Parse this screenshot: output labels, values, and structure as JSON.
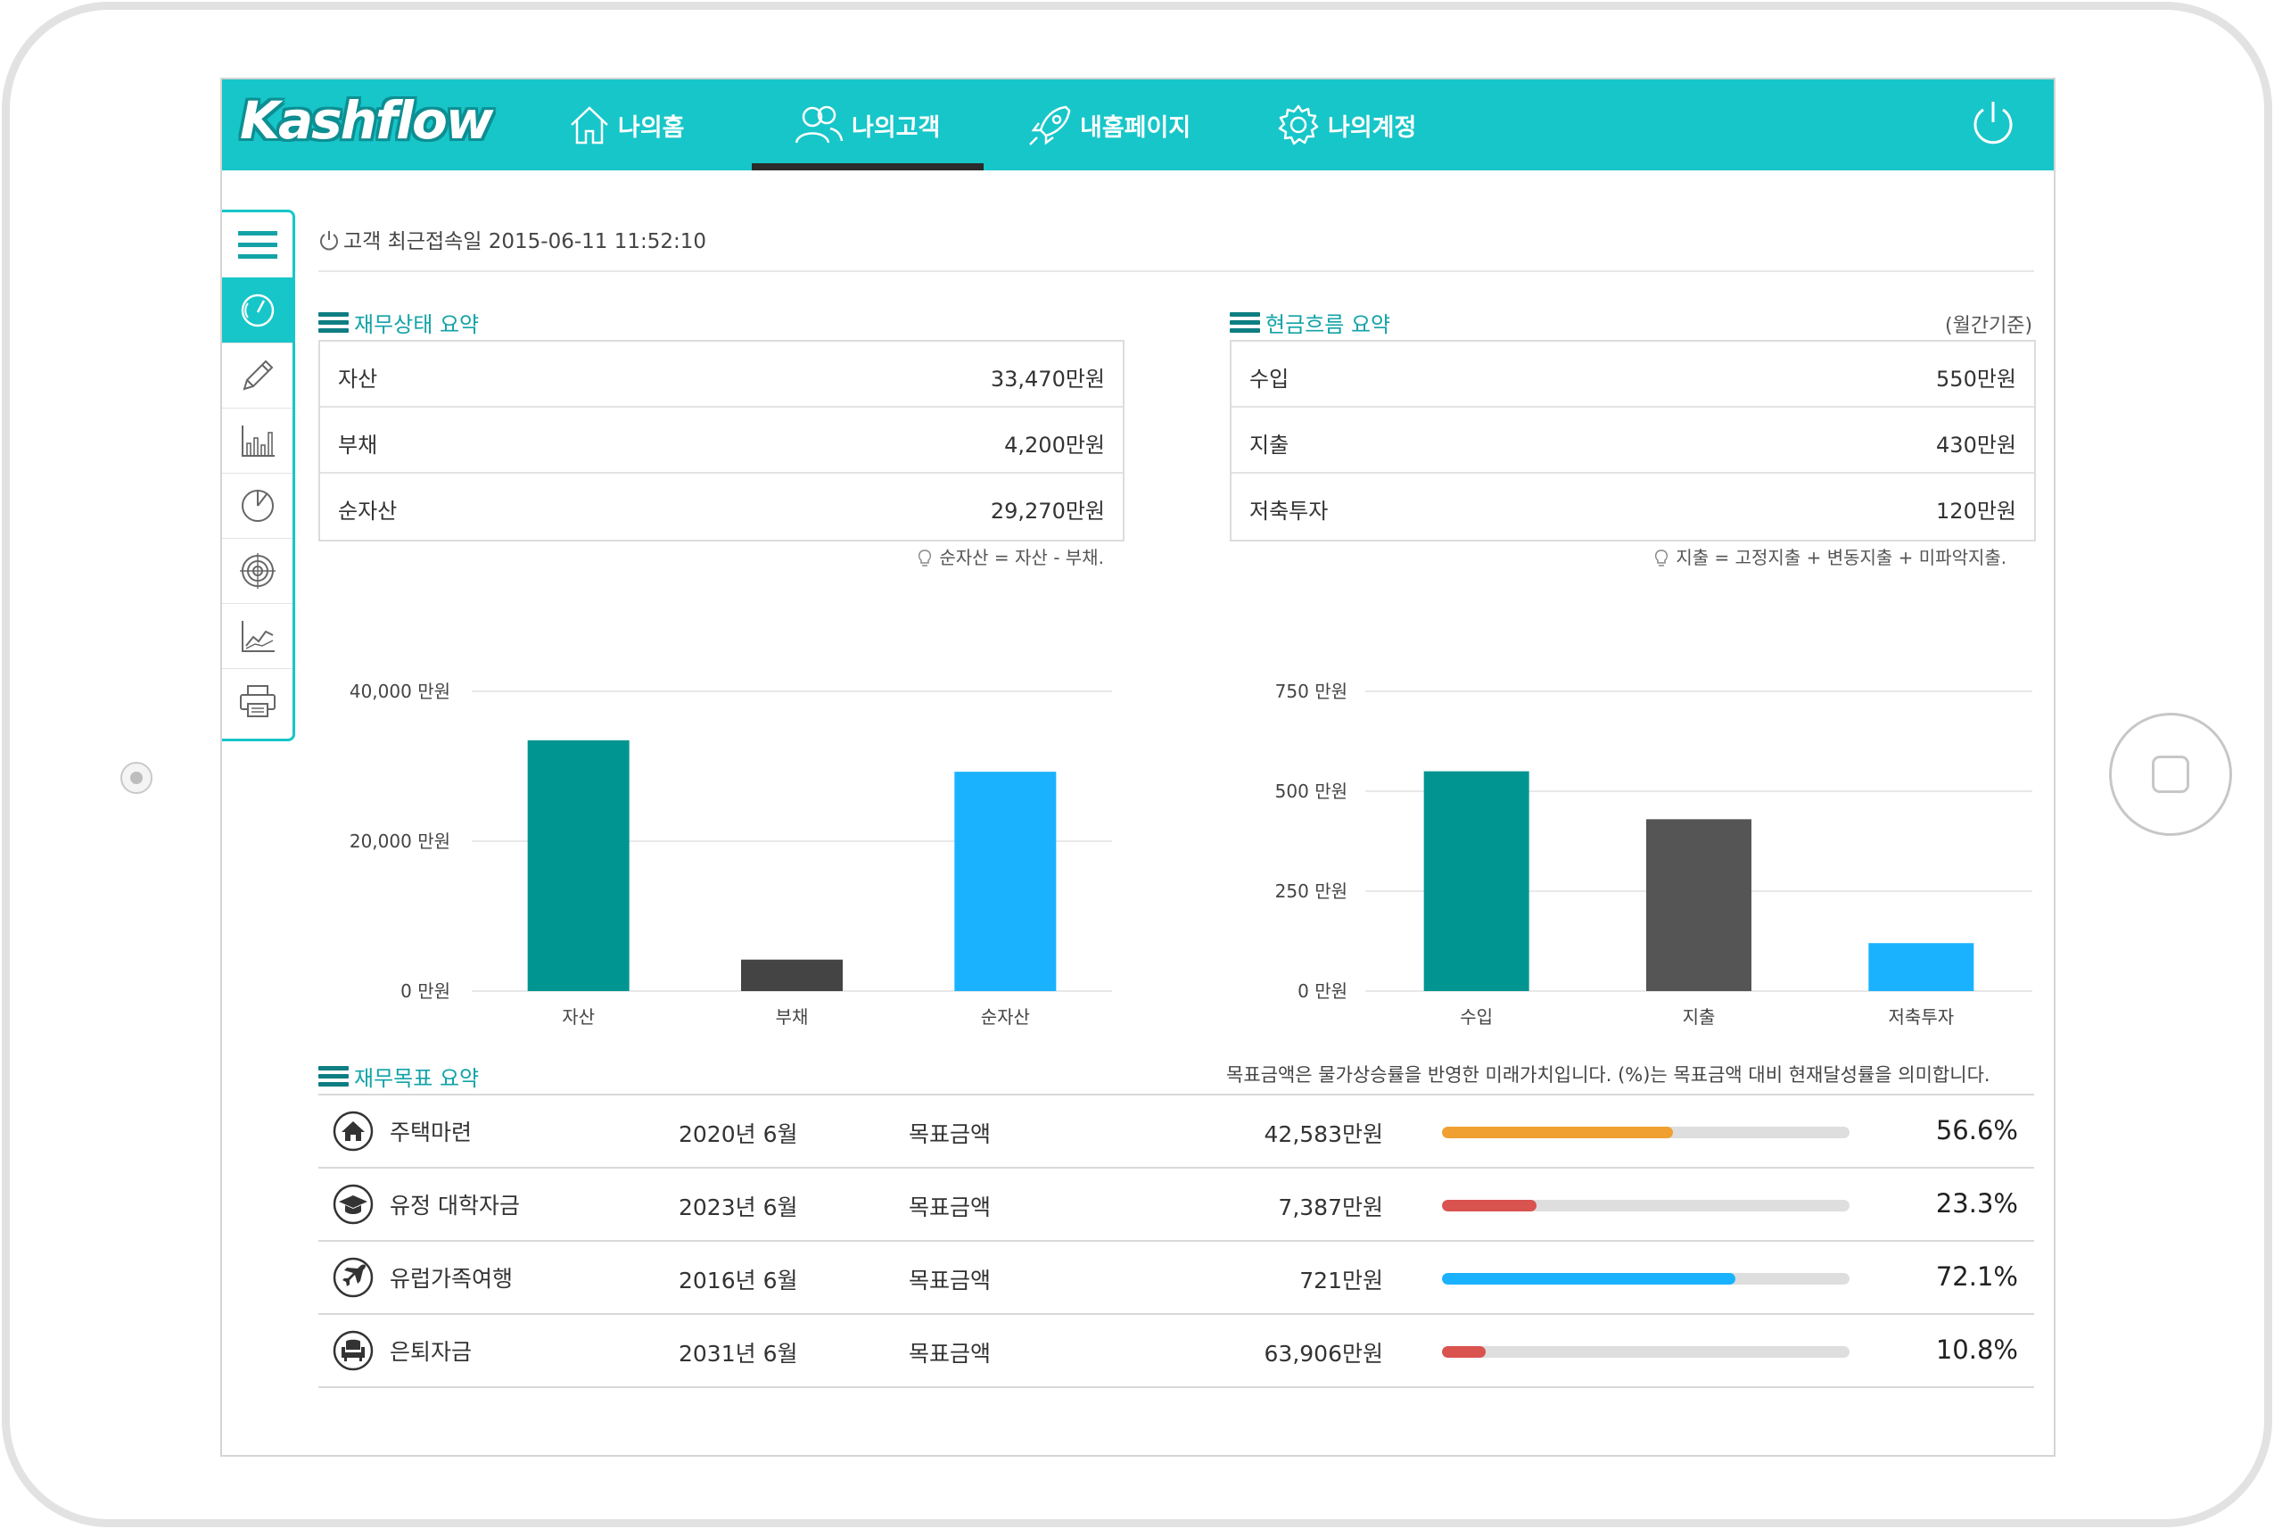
{
  "brand": {
    "logo": "Kashflow",
    "accent": "#17c6c9",
    "accent_dark": "#0e7e82"
  },
  "nav": [
    {
      "label": "나의홈",
      "icon": "home-icon"
    },
    {
      "label": "나의고객",
      "icon": "customers-icon",
      "active": true
    },
    {
      "label": "내홈페이지",
      "icon": "rocket-icon"
    },
    {
      "label": "나의계정",
      "icon": "gear-icon"
    }
  ],
  "sidebar": [
    {
      "icon": "menu-icon"
    },
    {
      "icon": "dashboard-gauge-icon",
      "active": true
    },
    {
      "icon": "pencil-icon"
    },
    {
      "icon": "bar-chart-icon"
    },
    {
      "icon": "pie-chart-icon"
    },
    {
      "icon": "target-icon"
    },
    {
      "icon": "line-chart-icon"
    },
    {
      "icon": "printer-icon"
    }
  ],
  "last_login": "고객 최근접속일 2015-06-11 11:52:10",
  "finance": {
    "title": "재무상태 요약",
    "rows": [
      {
        "label": "자산",
        "value": "33,470만원"
      },
      {
        "label": "부채",
        "value": "4,200만원"
      },
      {
        "label": "순자산",
        "value": "29,270만원"
      }
    ],
    "note": "순자산 = 자산 - 부채."
  },
  "cashflow": {
    "title": "현금흐름 요약",
    "basis": "(월간기준)",
    "rows": [
      {
        "label": "수입",
        "value": "550만원"
      },
      {
        "label": "지출",
        "value": "430만원"
      },
      {
        "label": "저축투자",
        "value": "120만원"
      }
    ],
    "note": "지출 = 고정지출 + 변동지출 + 미파악지출."
  },
  "chart_data": [
    {
      "type": "bar",
      "categories": [
        "자산",
        "부채",
        "순자산"
      ],
      "values": [
        33470,
        4200,
        29270
      ],
      "colors": [
        "#009591",
        "#444444",
        "#1ab2ff"
      ],
      "yticks": [
        "40,000 만원",
        "20,000 만원",
        "0 만원"
      ],
      "ylim": [
        0,
        40000
      ],
      "grid": true
    },
    {
      "type": "bar",
      "categories": [
        "수입",
        "지출",
        "저축투자"
      ],
      "values": [
        550,
        430,
        120
      ],
      "colors": [
        "#009591",
        "#555555",
        "#1ab2ff"
      ],
      "yticks": [
        "750 만원",
        "500 만원",
        "250 만원",
        "0 만원"
      ],
      "ylim": [
        0,
        750
      ],
      "grid": true
    }
  ],
  "goals": {
    "title": "재무목표 요약",
    "note": "목표금액은 물가상승률을 반영한 미래가치입니다. (%)는 목표금액 대비 현재달성률을 의미합니다.",
    "rows": [
      {
        "icon": "house-icon",
        "name": "주택마련",
        "date": "2020년 6월",
        "label": "목표금액",
        "amount": "42,583만원",
        "progress": 0.566,
        "percent": "56.6%",
        "color": "#f0a030"
      },
      {
        "icon": "graduation-cap-icon",
        "name": "유정 대학자금",
        "date": "2023년 6월",
        "label": "목표금액",
        "amount": "7,387만원",
        "progress": 0.233,
        "percent": "23.3%",
        "color": "#d9534f"
      },
      {
        "icon": "airplane-icon",
        "name": "유럽가족여행",
        "date": "2016년 6월",
        "label": "목표금액",
        "amount": "721만원",
        "progress": 0.721,
        "percent": "72.1%",
        "color": "#1ab2ff"
      },
      {
        "icon": "armchair-icon",
        "name": "은퇴자금",
        "date": "2031년 6월",
        "label": "목표금액",
        "amount": "63,906만원",
        "progress": 0.108,
        "percent": "10.8%",
        "color": "#d9534f"
      }
    ]
  }
}
